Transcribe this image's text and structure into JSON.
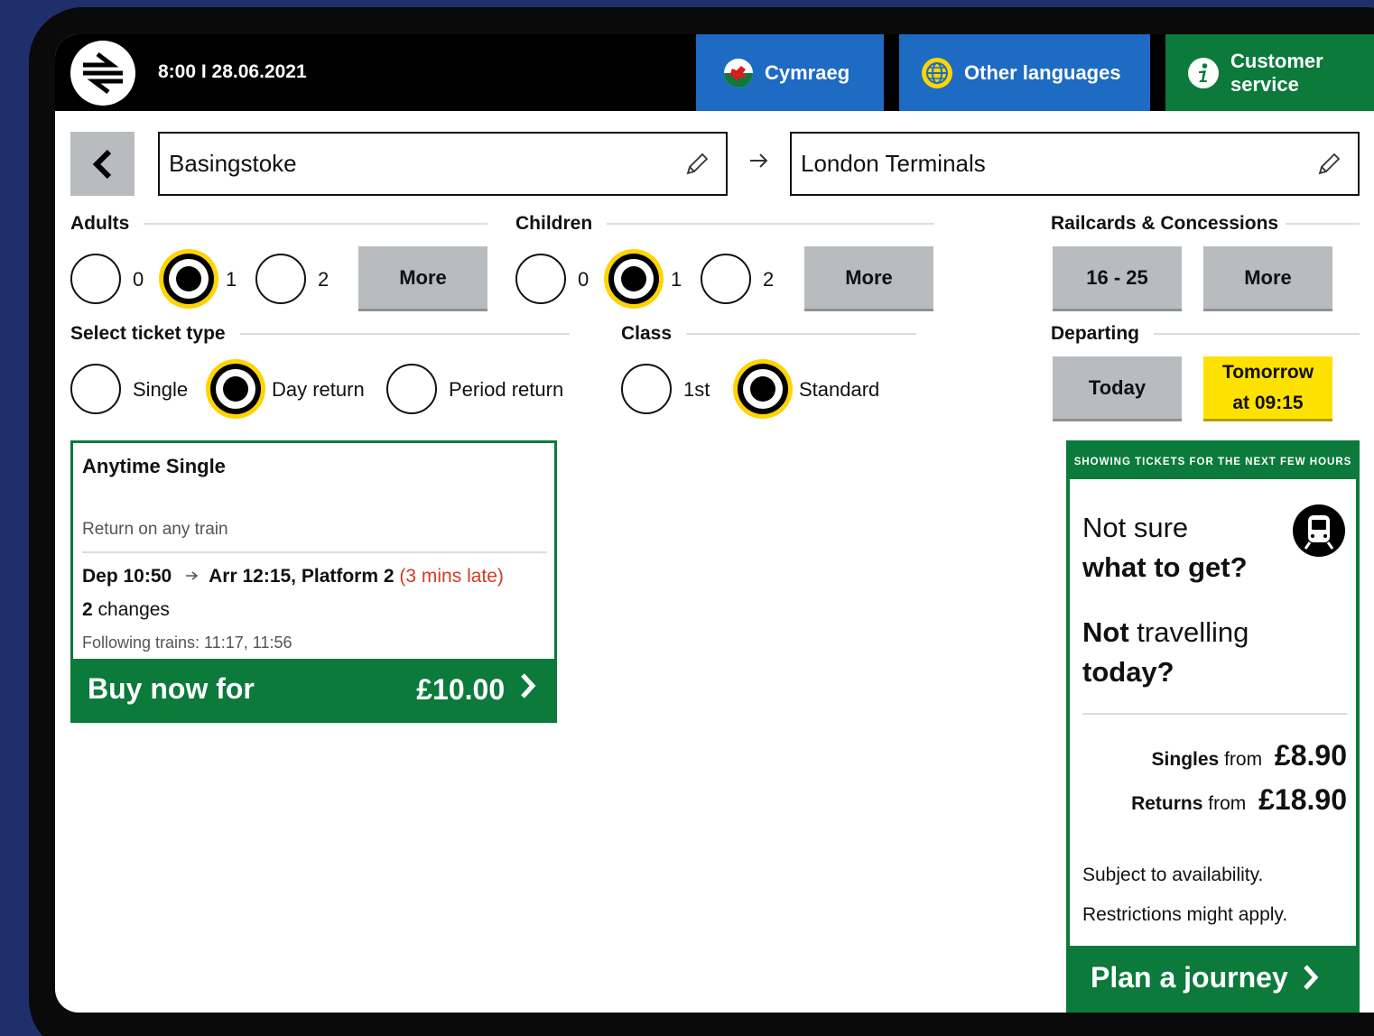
{
  "header": {
    "clock": "8:00 I 28.06.2021",
    "welsh_label": "Cymraeg",
    "languages_label": "Other languages",
    "customer_service_line1": "Customer",
    "customer_service_line2": "service"
  },
  "journey": {
    "from": "Basingstoke",
    "to": "London Terminals"
  },
  "adults": {
    "label": "Adults",
    "options": [
      "0",
      "1",
      "2"
    ],
    "selected": "1",
    "more_label": "More"
  },
  "children": {
    "label": "Children",
    "options": [
      "0",
      "1",
      "2"
    ],
    "selected": "1",
    "more_label": "More"
  },
  "railcards": {
    "label": "Railcards & Concessions",
    "options": [
      "16 - 25",
      "More"
    ]
  },
  "ticket_type": {
    "label": "Select ticket type",
    "options": [
      "Single",
      "Day return",
      "Period return"
    ],
    "selected": "Day return"
  },
  "class": {
    "label": "Class",
    "options": [
      "1st",
      "Standard"
    ],
    "selected": "Standard"
  },
  "departing": {
    "label": "Departing",
    "today_label": "Today",
    "tomorrow_line1": "Tomorrow",
    "tomorrow_line2": "at 09:15"
  },
  "ticket": {
    "title": "Anytime Single",
    "subtitle": "Return on any train",
    "dep": "Dep 10:50",
    "arr": "Arr 12:15, Platform 2",
    "delay": "(3 mins late)",
    "changes_count": "2",
    "changes_label": "changes",
    "following": "Following  trains: 11:17, 11:56",
    "buy_label": "Buy now for",
    "price": "£10.00"
  },
  "panel": {
    "banner": "SHOWING TICKETS FOR THE NEXT FEW HOURS",
    "q1_line1": "Not sure",
    "q1_line2": "what to get?",
    "q2_not": "Not",
    "q2_rest": "travelling",
    "q2_line2": "today?",
    "singles_label": "Singles",
    "from_word": "from",
    "singles_price": "£8.90",
    "returns_label": "Returns",
    "returns_price": "£18.90",
    "note1": "Subject to availability.",
    "note2": "Restrictions might apply.",
    "plan_label": "Plan a journey"
  },
  "colors": {
    "green": "#0b7a3b",
    "blue": "#1d6bc2",
    "yellow": "#ffe100",
    "grey_button": "#b8bcbf",
    "late_red": "#d63a22"
  }
}
